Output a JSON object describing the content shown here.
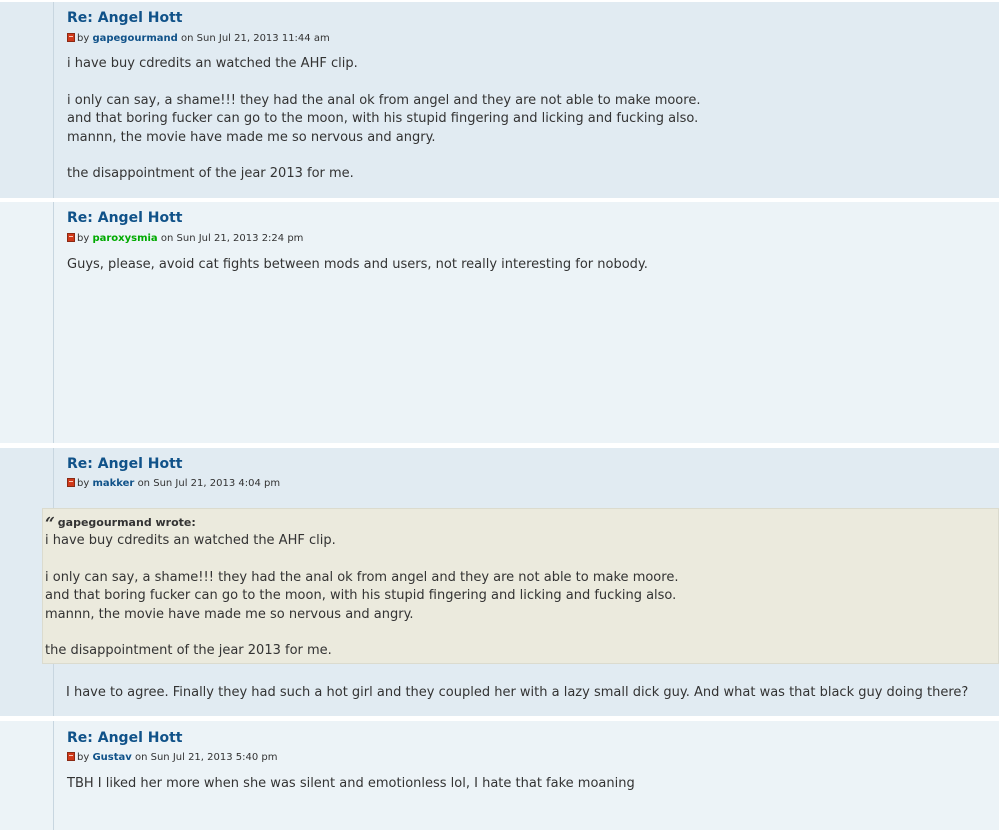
{
  "posts": [
    {
      "title": "Re: Angel Hott",
      "by": "by",
      "author": "gapegourmand",
      "on": "on",
      "date": "Sun Jul 21, 2013 11:44 am",
      "lines": [
        "i have buy cdredits an watched the AHF clip.",
        "",
        "i only can say, a shame!!! they had the anal ok from angel and they are not able to make moore.",
        "and that boring fucker can go to the moon, with his stupid fingering and licking and fucking also.",
        "mannn, the movie have made me so nervous and angry.",
        "",
        "the disappointment of the jear 2013 for me."
      ]
    },
    {
      "title": "Re: Angel Hott",
      "by": "by",
      "author": "paroxysmia",
      "on": "on",
      "date": "Sun Jul 21, 2013 2:24 pm",
      "lines": [
        "Guys, please, avoid cat fights between mods and users, not really interesting for nobody."
      ]
    },
    {
      "title": "Re: Angel Hott",
      "by": "by",
      "author": "makker",
      "on": "on",
      "date": "Sun Jul 21, 2013 4:04 pm",
      "quote": {
        "cite": "gapegourmand wrote:",
        "lines": [
          "i have buy cdredits an watched the AHF clip.",
          "",
          "i only can say, a shame!!! they had the anal ok from angel and they are not able to make moore.",
          "and that boring fucker can go to the moon, with his stupid fingering and licking and fucking also.",
          "mannn, the movie have made me so nervous and angry.",
          "",
          "the disappointment of the jear 2013 for me."
        ]
      },
      "lines": [
        "I have to agree. Finally they had such a hot girl and they coupled her with a lazy small dick guy. And what was that black guy doing there?"
      ]
    },
    {
      "title": "Re: Angel Hott",
      "by": "by",
      "author": "Gustav",
      "on": "on",
      "date": "Sun Jul 21, 2013 5:40 pm",
      "lines": [
        "TBH I liked her more when she was silent and emotionless lol, I hate that fake moaning"
      ]
    }
  ],
  "colors": {
    "post_bg_dark": "#e1ebf2",
    "post_bg_light": "#ecf3f7",
    "title": "#105289",
    "moderator": "#00aa00",
    "quote_bg": "#ebeadd"
  },
  "icons": {
    "post_icon": "post-icon"
  }
}
